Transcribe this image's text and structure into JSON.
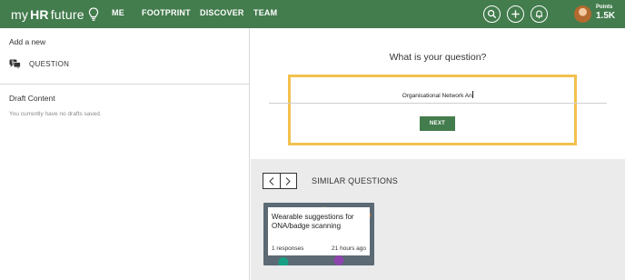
{
  "header": {
    "logo": {
      "my": "my",
      "hr": "HR",
      "future": "future"
    },
    "nav": [
      {
        "label": "ME"
      },
      {
        "label": "FOOTPRINT"
      },
      {
        "label": "DISCOVER"
      },
      {
        "label": "TEAM"
      }
    ],
    "icons": [
      "search-icon",
      "plus-icon",
      "bell-icon"
    ],
    "points_label": "Points",
    "points_value": "1.5K",
    "brand_color": "#437c4d"
  },
  "sidebar": {
    "add_new_title": "Add a new",
    "add_items": [
      {
        "label": "QUESTION",
        "icon": "question-icon"
      }
    ],
    "drafts_title": "Draft Content",
    "drafts_empty": "You currently have no drafts saved."
  },
  "question_form": {
    "heading": "What is your question?",
    "input_value": "Organisational Network An",
    "next_label": "NEXT",
    "highlight_color": "#f2c14e"
  },
  "similar": {
    "title": "SIMILAR QUESTIONS",
    "cards": [
      {
        "title": "Wearable suggestions for ONA/badge scanning",
        "responses": "1 responses",
        "time": "21 hours ago"
      }
    ]
  }
}
